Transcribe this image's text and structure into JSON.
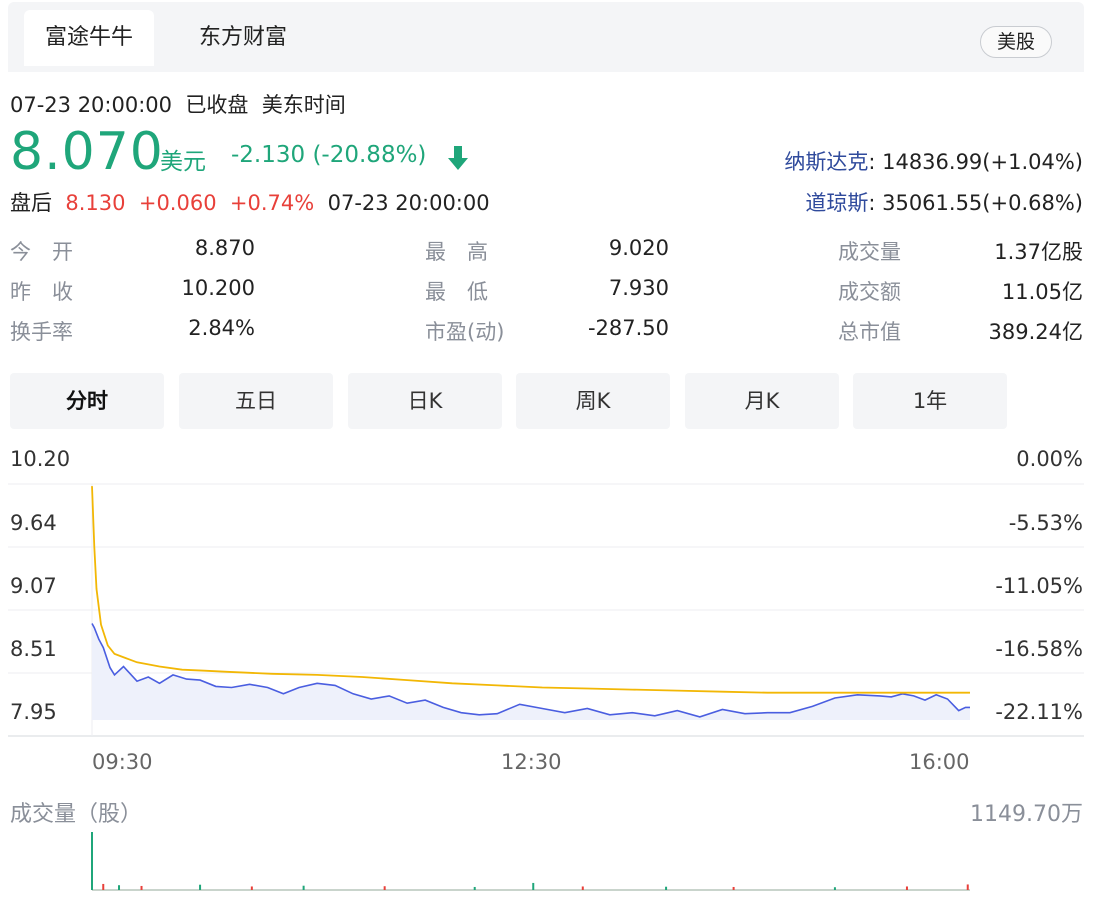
{
  "source_tabs": [
    "富途牛牛",
    "东方财富"
  ],
  "market": "美股",
  "status": {
    "datetime": "07-23 20:00:00",
    "state": "已收盘",
    "tz": "美东时间"
  },
  "quote": {
    "price": "8.070",
    "currency": "美元",
    "change": "-2.130 (-20.88%)",
    "after_label": "盘后",
    "after_price": "8.130",
    "after_change": "+0.060",
    "after_pct": "+0.74%",
    "after_time": "07-23 20:00:00"
  },
  "indices": [
    {
      "name": "纳斯达克",
      "value": ": 14836.99(+1.04%)"
    },
    {
      "name": "道琼斯",
      "value": ": 35061.55(+0.68%)"
    }
  ],
  "stats": {
    "open_label": "今　开",
    "open": "8.870",
    "prev_label": "昨　收",
    "prev": "10.200",
    "turnover_label": "换手率",
    "turnover": "2.84%",
    "high_label": "最　高",
    "high": "9.020",
    "low_label": "最　低",
    "low": "7.930",
    "pe_label": "市盈(动)",
    "pe": "-287.50",
    "vol_label": "成交量",
    "vol": "1.37亿股",
    "amt_label": "成交额",
    "amt": "11.05亿",
    "cap_label": "总市值",
    "cap": "389.24亿"
  },
  "period_tabs": [
    "分时",
    "五日",
    "日K",
    "周K",
    "月K",
    "1年"
  ],
  "colors": {
    "up": "#e8403a",
    "down": "#1fa67a",
    "price_line": "#4a5ee0",
    "avg_line": "#f2b705",
    "link": "#2f4a9c"
  },
  "chart_data": {
    "type": "line",
    "y_labels_left": [
      "10.20",
      "9.64",
      "9.07",
      "8.51",
      "7.95"
    ],
    "y_labels_right": [
      "0.00%",
      "-5.53%",
      "-11.05%",
      "-16.58%",
      "-22.11%"
    ],
    "x_labels": [
      "09:30",
      "12:30",
      "16:00"
    ],
    "ylim": [
      7.95,
      10.2
    ],
    "xlim": [
      0,
      390
    ],
    "series": [
      {
        "x": [
          0,
          1,
          3,
          5,
          8,
          10,
          14,
          20,
          25,
          30,
          36,
          42,
          48,
          55,
          62,
          70,
          78,
          85,
          92,
          100,
          108,
          116,
          124,
          132,
          140,
          148,
          156,
          164,
          172,
          180,
          190,
          200,
          210,
          220,
          230,
          240,
          250,
          260,
          270,
          280,
          290,
          300,
          310,
          320,
          330,
          340,
          350,
          355,
          360,
          365,
          370,
          375,
          380,
          385,
          388,
          390
        ],
        "y": [
          8.87,
          8.83,
          8.72,
          8.64,
          8.45,
          8.38,
          8.46,
          8.32,
          8.36,
          8.3,
          8.38,
          8.34,
          8.33,
          8.27,
          8.26,
          8.29,
          8.26,
          8.2,
          8.26,
          8.3,
          8.28,
          8.2,
          8.15,
          8.18,
          8.11,
          8.14,
          8.07,
          8.02,
          8.0,
          8.01,
          8.1,
          8.06,
          8.02,
          8.06,
          8.0,
          8.02,
          7.99,
          8.04,
          7.98,
          8.05,
          8.01,
          8.02,
          8.02,
          8.08,
          8.16,
          8.19,
          8.18,
          8.17,
          8.2,
          8.18,
          8.14,
          8.19,
          8.15,
          8.04,
          8.07,
          8.07
        ]
      },
      {
        "x": [
          0,
          1,
          2,
          4,
          7,
          10,
          15,
          20,
          25,
          30,
          40,
          50,
          60,
          70,
          80,
          100,
          120,
          140,
          160,
          180,
          200,
          220,
          240,
          260,
          280,
          300,
          320,
          340,
          360,
          380,
          390
        ],
        "y": [
          10.18,
          9.6,
          9.2,
          8.86,
          8.66,
          8.58,
          8.54,
          8.5,
          8.48,
          8.46,
          8.43,
          8.42,
          8.41,
          8.4,
          8.39,
          8.38,
          8.36,
          8.33,
          8.3,
          8.28,
          8.26,
          8.25,
          8.24,
          8.23,
          8.22,
          8.21,
          8.21,
          8.21,
          8.21,
          8.21,
          8.21
        ]
      }
    ]
  },
  "volume": {
    "label": "成交量（股）",
    "max_label": "1149.70万",
    "max_value": 1149.7,
    "bars": [
      {
        "x": 0,
        "v": 1149.7,
        "up": false
      },
      {
        "x": 5,
        "v": 120,
        "up": true
      },
      {
        "x": 12,
        "v": 95,
        "up": false
      },
      {
        "x": 22,
        "v": 80,
        "up": true
      },
      {
        "x": 48,
        "v": 105,
        "up": false
      },
      {
        "x": 71,
        "v": 70,
        "up": true
      },
      {
        "x": 94,
        "v": 85,
        "up": false
      },
      {
        "x": 130,
        "v": 75,
        "up": true
      },
      {
        "x": 170,
        "v": 60,
        "up": false
      },
      {
        "x": 196,
        "v": 140,
        "up": false
      },
      {
        "x": 218,
        "v": 70,
        "up": true
      },
      {
        "x": 255,
        "v": 65,
        "up": false
      },
      {
        "x": 285,
        "v": 60,
        "up": true
      },
      {
        "x": 330,
        "v": 55,
        "up": false
      },
      {
        "x": 362,
        "v": 70,
        "up": true
      },
      {
        "x": 389,
        "v": 110,
        "up": true
      }
    ]
  }
}
